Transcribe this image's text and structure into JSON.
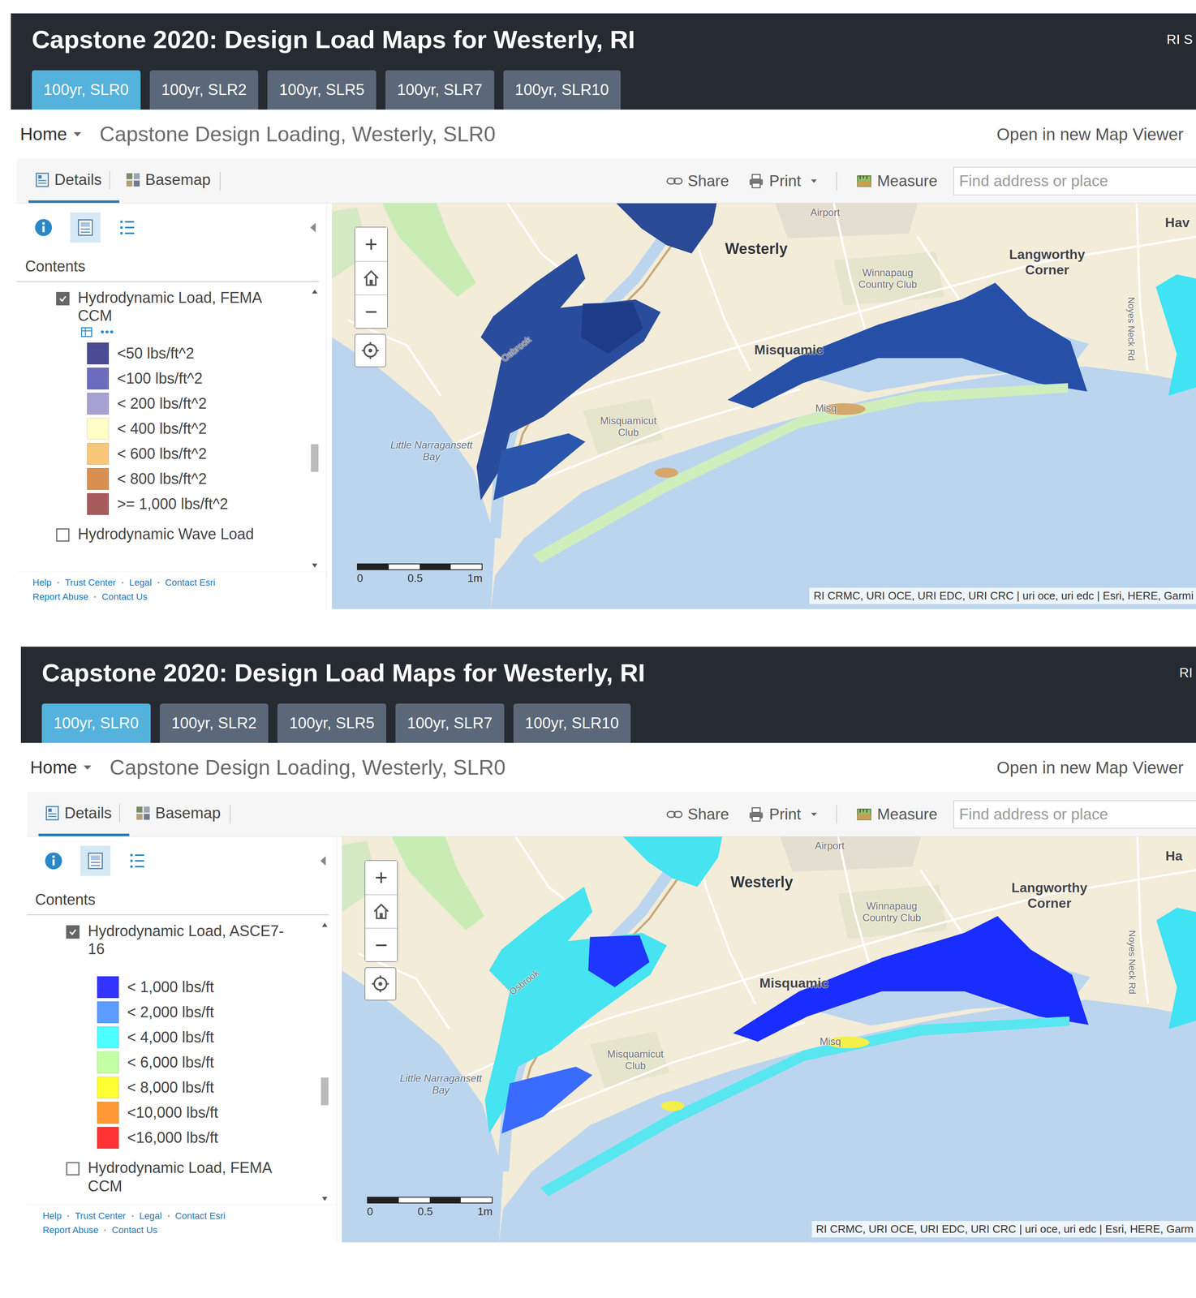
{
  "panels": [
    {
      "app_title": "Capstone 2020: Design Load Maps for Westerly, RI",
      "header_right": "RI S",
      "tabs": [
        {
          "label": "100yr, SLR0",
          "selected": true
        },
        {
          "label": "100yr, SLR2",
          "selected": false
        },
        {
          "label": "100yr, SLR5",
          "selected": false
        },
        {
          "label": "100yr, SLR7",
          "selected": false
        },
        {
          "label": "100yr, SLR10",
          "selected": false
        }
      ],
      "home": "Home",
      "map_title": "Capstone Design Loading, Westerly, SLR0",
      "open_viewer": "Open in new Map Viewer",
      "toolbar": {
        "tabs": [
          {
            "label": "Details",
            "selected": true
          },
          {
            "label": "Basemap",
            "selected": false
          }
        ],
        "share": "Share",
        "print": "Print",
        "measure": "Measure",
        "search_placeholder": "Find address or place"
      },
      "panes": [
        {
          "selected": false
        },
        {
          "selected": true
        },
        {
          "selected": false
        }
      ],
      "contents_label": "Contents",
      "layers": [
        {
          "name": "Hydrodynamic Load, FEMA CCM",
          "checked": true,
          "tools": "•••",
          "legend": [
            {
              "label": "<50 lbs/ft^2",
              "color": "#4b4b94"
            },
            {
              "label": "<100 lbs/ft^2",
              "color": "#6b6bbf"
            },
            {
              "label": "< 200 lbs/ft^2",
              "color": "#a6a1d2"
            },
            {
              "label": "< 400 lbs/ft^2",
              "color": "#ffffc8"
            },
            {
              "label": "< 600 lbs/ft^2",
              "color": "#f8c77a"
            },
            {
              "label": "< 800 lbs/ft^2",
              "color": "#d98f52"
            },
            {
              "label": ">= 1,000 lbs/ft^2",
              "color": "#a65c5c"
            }
          ]
        },
        {
          "name": "Hydrodynamic Wave Load",
          "checked": false,
          "legend": []
        }
      ],
      "footer_links": [
        "Help",
        "Trust Center",
        "Legal",
        "Contact Esri",
        "Report Abuse",
        "Contact Us"
      ],
      "map": {
        "labels": [
          "Westerly",
          "Airport",
          "Winnapaug Country Club",
          "Langworthy Corner",
          "Misquamic",
          "Misquamicut Club",
          "Little Narragansett Bay",
          "Osbrook",
          "Noyes Neck Rd",
          "Hav",
          "Misq"
        ],
        "zoom_in": "+",
        "zoom_out": "−",
        "scale": [
          "0",
          "0.5",
          "1m"
        ],
        "attribution": "RI CRMC, URI OCE, URI EDC, URI CRC | uri oce, uri edc | Esri, HERE, Garmi"
      }
    },
    {
      "app_title": "Capstone 2020: Design Load Maps for Westerly, RI",
      "header_right": "RI",
      "tabs": [
        {
          "label": "100yr, SLR0",
          "selected": true
        },
        {
          "label": "100yr, SLR2",
          "selected": false
        },
        {
          "label": "100yr, SLR5",
          "selected": false
        },
        {
          "label": "100yr, SLR7",
          "selected": false
        },
        {
          "label": "100yr, SLR10",
          "selected": false
        }
      ],
      "home": "Home",
      "map_title": "Capstone Design Loading, Westerly, SLR0",
      "open_viewer": "Open in new Map Viewer",
      "toolbar": {
        "tabs": [
          {
            "label": "Details",
            "selected": true
          },
          {
            "label": "Basemap",
            "selected": false
          }
        ],
        "share": "Share",
        "print": "Print",
        "measure": "Measure",
        "search_placeholder": "Find address or place"
      },
      "panes": [
        {
          "selected": false
        },
        {
          "selected": true
        },
        {
          "selected": false
        }
      ],
      "contents_label": "Contents",
      "layers": [
        {
          "name": "Hydrodynamic Load, ASCE7-16",
          "checked": true,
          "legend": [
            {
              "label": "< 1,000 lbs/ft",
              "color": "#3333ff"
            },
            {
              "label": "< 2,000 lbs/ft",
              "color": "#5c9cff"
            },
            {
              "label": "< 4,000 lbs/ft",
              "color": "#4dffff"
            },
            {
              "label": "< 6,000 lbs/ft",
              "color": "#c3ffa3"
            },
            {
              "label": "< 8,000 lbs/ft",
              "color": "#ffff33"
            },
            {
              "label": "<10,000 lbs/ft",
              "color": "#ff9933"
            },
            {
              "label": "<16,000 lbs/ft",
              "color": "#ff3333"
            }
          ]
        },
        {
          "name": "Hydrodynamic Load, FEMA CCM",
          "checked": false,
          "legend": []
        }
      ],
      "footer_links": [
        "Help",
        "Trust Center",
        "Legal",
        "Contact Esri",
        "Report Abuse",
        "Contact Us"
      ],
      "map": {
        "labels": [
          "Westerly",
          "Airport",
          "Winnapaug Country Club",
          "Langworthy Corner",
          "Misquamic",
          "Misquamicut Club",
          "Little Narragansett Bay",
          "Osbrook",
          "Noyes Neck Rd",
          "Ha",
          "Misq"
        ],
        "zoom_in": "+",
        "zoom_out": "−",
        "scale": [
          "0",
          "0.5",
          "1m"
        ],
        "attribution": "RI CRMC, URI OCE, URI EDC, URI CRC | uri oce, uri edc | Esri, HERE, Garm"
      }
    }
  ]
}
